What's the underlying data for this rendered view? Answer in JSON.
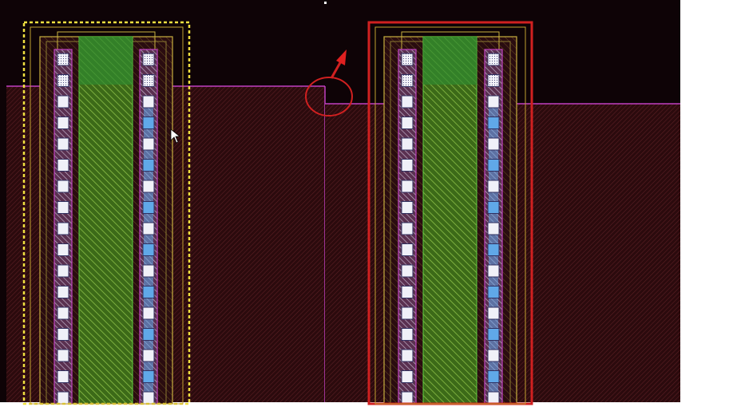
{
  "view": {
    "background": "#0e0306",
    "outer_background": "#ffffff"
  },
  "colors": {
    "well": "#3a0f12",
    "well_hatch": "#6b2a2e",
    "well_edge": "#c040c0",
    "metal_track": "#c8b040",
    "metal_track_dim": "#8a7a30",
    "diffusion": "#4a8a20",
    "diffusion_hatch": "#7ab040",
    "contact_fill": "#f0f0f8",
    "contact_edge": "#303060",
    "via_fill": "#60a8e8",
    "poly_pink": "#c040c0",
    "selection_dashed": "#f0e040",
    "highlight": "#d02020",
    "gray_hatch": "#b0a0b8"
  },
  "annotations": {
    "circle": "error-marker-circle",
    "arrow": "pointer-arrow"
  },
  "cursor": {
    "icon": "mouse-pointer-icon"
  }
}
